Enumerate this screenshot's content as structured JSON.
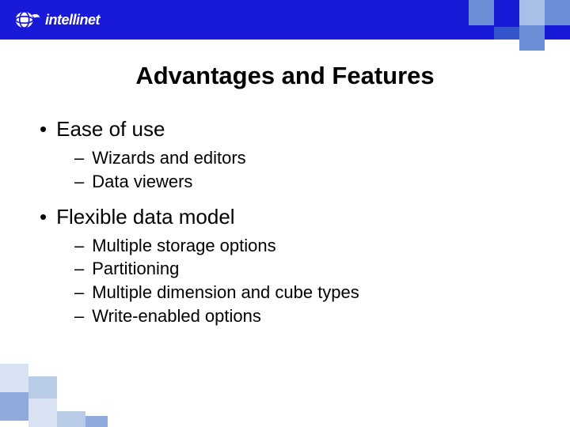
{
  "brand": "intellinet",
  "title": "Advantages and Features",
  "sections": [
    {
      "heading": "Ease of use",
      "items": [
        "Wizards and editors",
        "Data viewers"
      ]
    },
    {
      "heading": "Flexible data model",
      "items": [
        "Multiple storage options",
        "Partitioning",
        "Multiple dimension and cube types",
        "Write-enabled options"
      ]
    }
  ],
  "colors": {
    "header": "#1919d8",
    "accent1": "#6b8fd6",
    "accent2": "#a8c0e8",
    "accent3": "#3355cc"
  }
}
